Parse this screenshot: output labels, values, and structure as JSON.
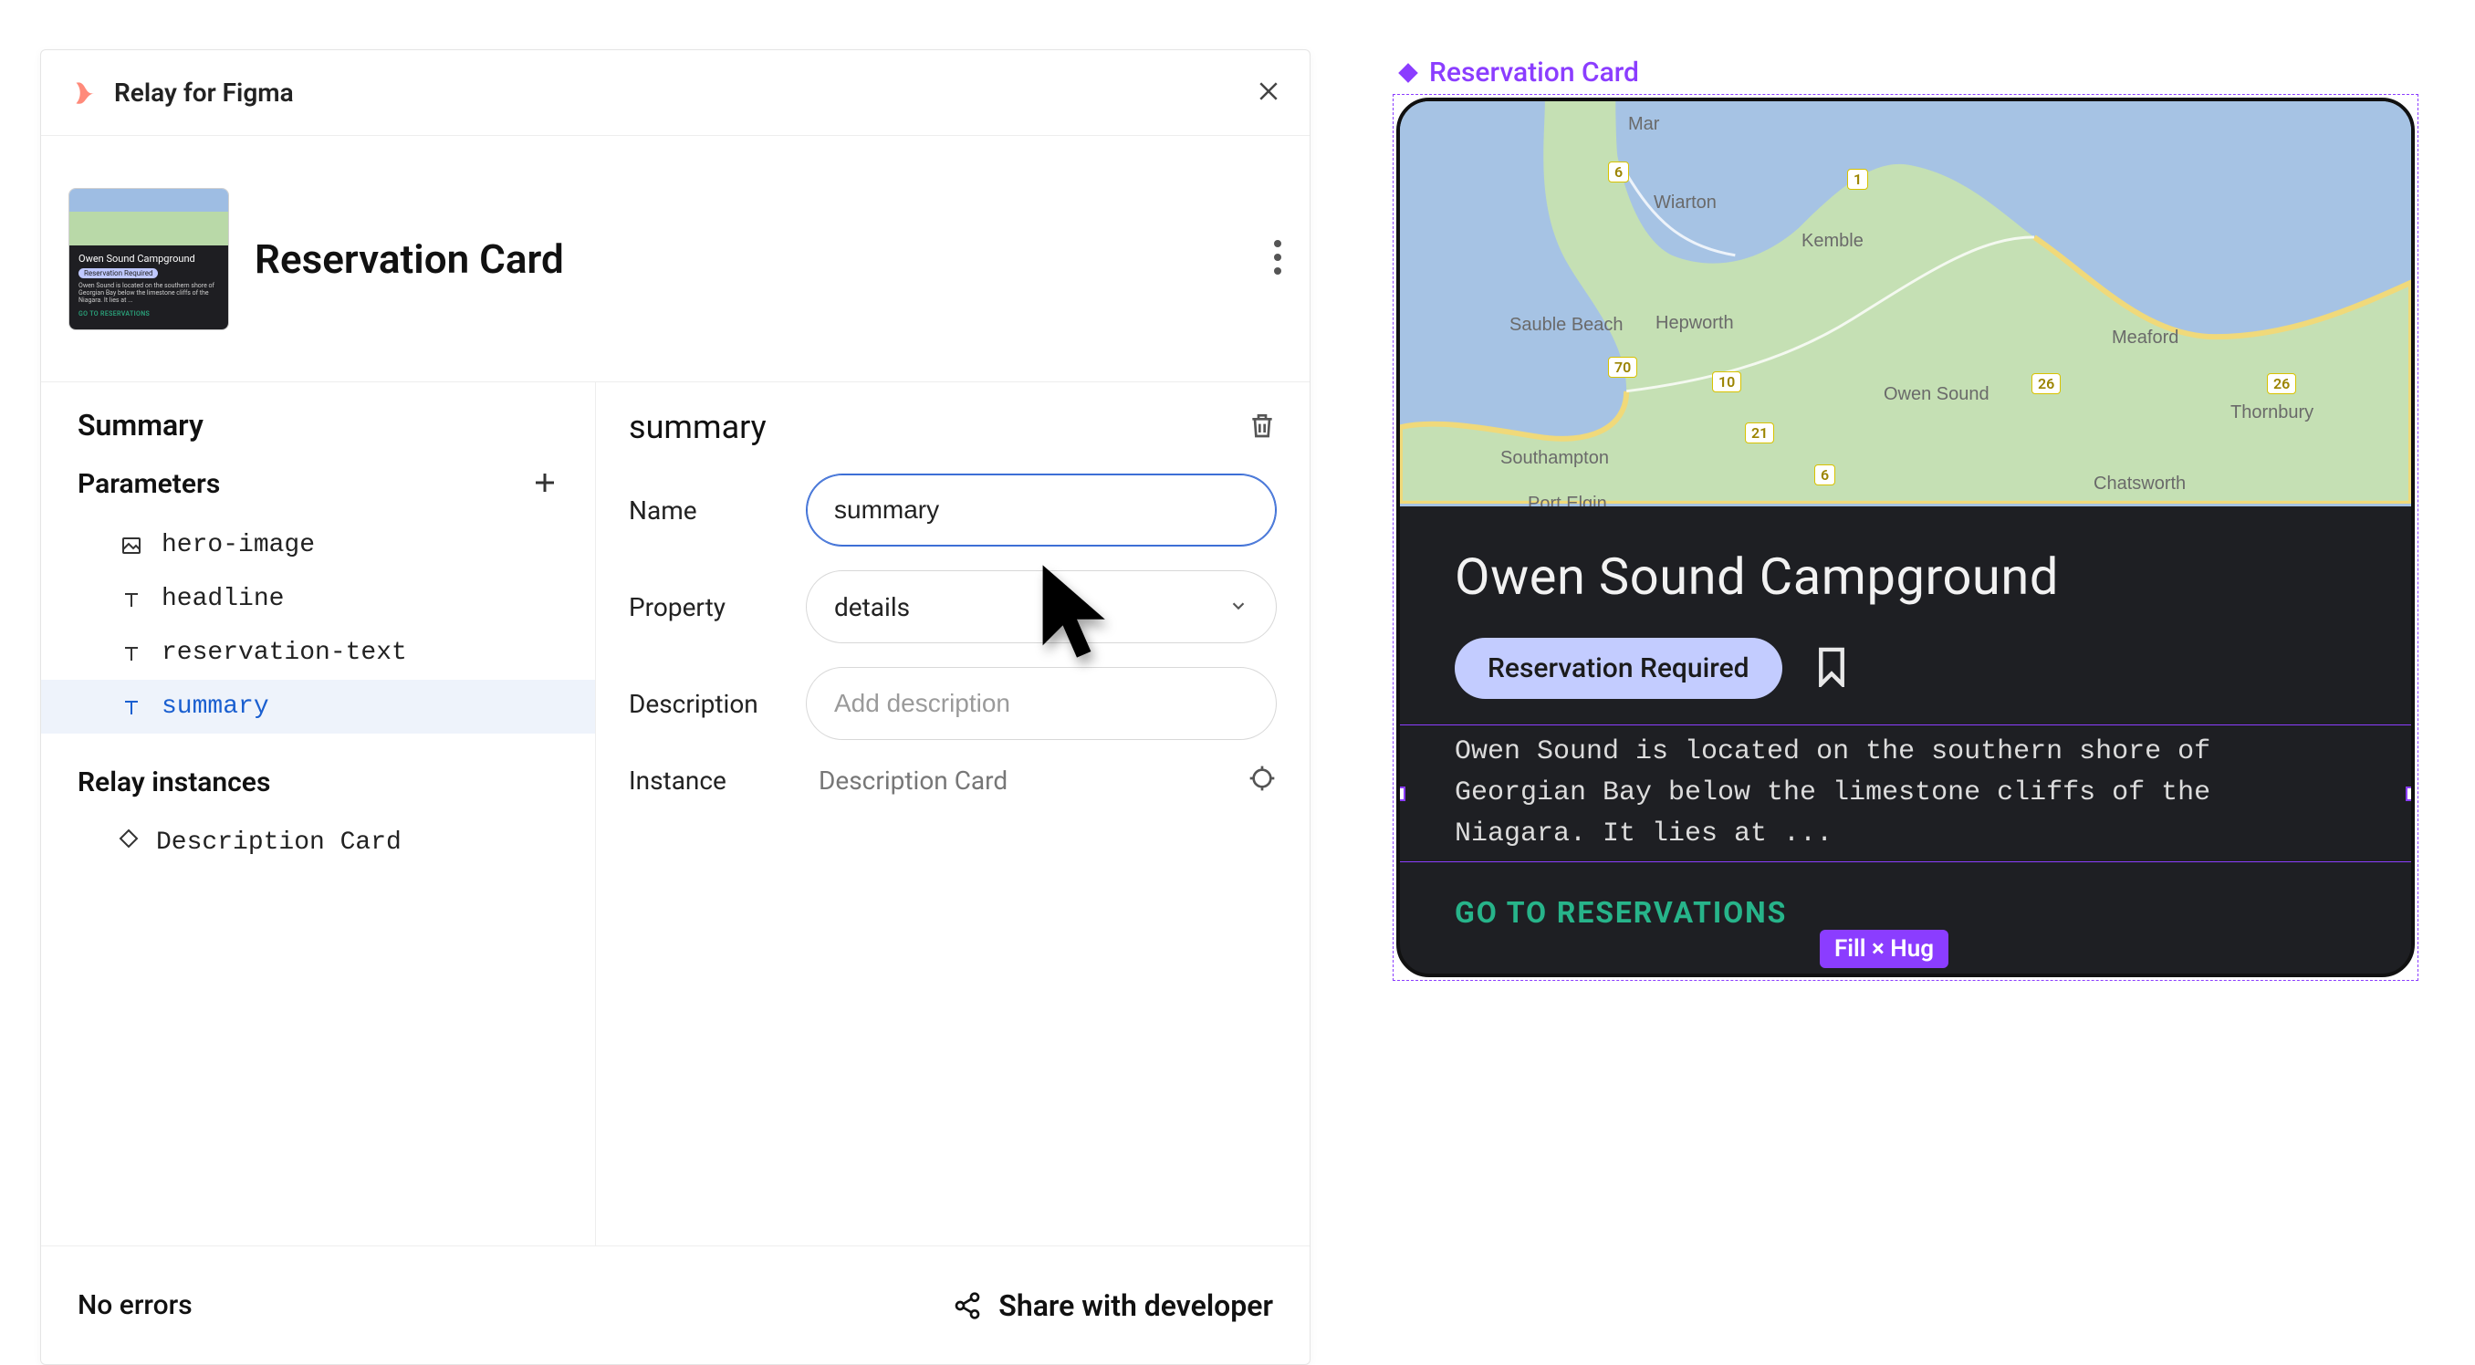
{
  "plugin": {
    "title": "Relay for Figma"
  },
  "component": {
    "name": "Reservation Card"
  },
  "left_panel": {
    "summary_heading": "Summary",
    "parameters_heading": "Parameters",
    "parameters": [
      {
        "id": "hero-image",
        "label": "hero-image",
        "icon": "image"
      },
      {
        "id": "headline",
        "label": "headline",
        "icon": "text"
      },
      {
        "id": "reservation-text",
        "label": "reservation-text",
        "icon": "text"
      },
      {
        "id": "summary",
        "label": "summary",
        "icon": "text",
        "active": true
      }
    ],
    "relay_instances_heading": "Relay instances",
    "instances": [
      {
        "label": "Description Card"
      }
    ]
  },
  "form": {
    "title": "summary",
    "name_label": "Name",
    "name_value": "summary",
    "property_label": "Property",
    "property_value": "details",
    "description_label": "Description",
    "description_placeholder": "Add description",
    "instance_label": "Instance",
    "instance_value": "Description Card"
  },
  "footer": {
    "status": "No errors",
    "share_label": "Share with developer"
  },
  "canvas": {
    "component_label": "Reservation Card",
    "selection_badge": "Fill × Hug"
  },
  "card": {
    "title": "Owen Sound Campground",
    "chip": "Reservation Required",
    "summary": "Owen Sound is located on the southern shore of Georgian Bay below the limestone cliffs of the Niagara. It lies at ...",
    "cta": "GO TO RESERVATIONS"
  },
  "map_places": {
    "mar": "Mar",
    "wiarton": "Wiarton",
    "kemble": "Kemble",
    "sauble": "Sauble Beach",
    "hepworth": "Hepworth",
    "owen": "Owen Sound",
    "meaford": "Meaford",
    "thornbury": "Thornbury",
    "southampton": "Southampton",
    "portelgin": "Port Elgin",
    "chatsworth": "Chatsworth"
  }
}
